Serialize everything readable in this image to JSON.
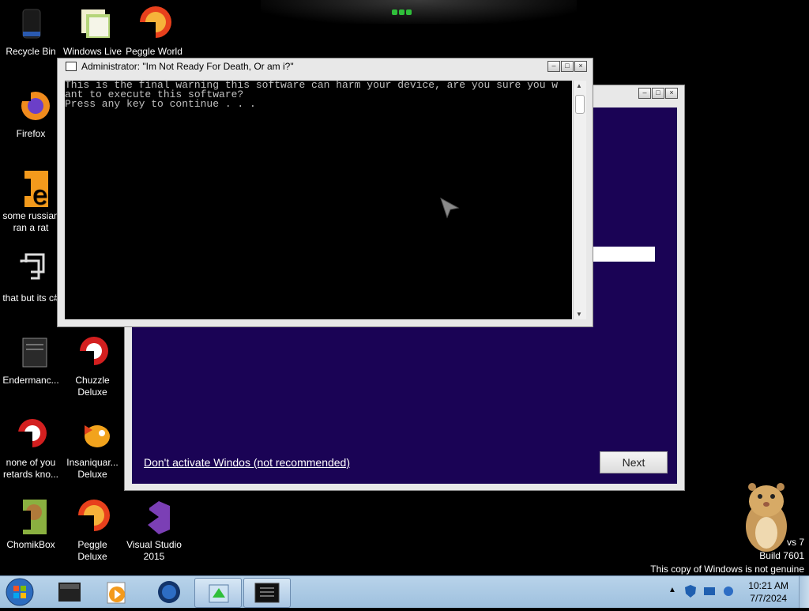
{
  "desktop": {
    "icons": [
      {
        "name": "recycle-bin-icon",
        "label": "Recycle Bin"
      },
      {
        "name": "windows-live-icon",
        "label": "Windows Live"
      },
      {
        "name": "peggle-world-icon",
        "label": "Peggle World"
      },
      {
        "name": "firefox-icon",
        "label": "Firefox"
      },
      {
        "name": "rat-icon",
        "label": "some russian ran a rat"
      },
      {
        "name": "csharp-icon",
        "label": "that but its c#"
      },
      {
        "name": "enderman-icon",
        "label": "Endermanc..."
      },
      {
        "name": "chuzzle-icon",
        "label": "Chuzzle Deluxe"
      },
      {
        "name": "none-of-you-icon",
        "label": "none of you retards kno..."
      },
      {
        "name": "insaniquarium-icon",
        "label": "Insaniquar... Deluxe"
      },
      {
        "name": "chomikbox-icon",
        "label": "ChomikBox"
      },
      {
        "name": "peggle-deluxe-icon",
        "label": "Peggle Deluxe"
      },
      {
        "name": "visual-studio-icon",
        "label": "Visual Studio 2015"
      }
    ]
  },
  "setup_window": {
    "link": "Don't activate Windos (not recommended)",
    "next_label": "Next"
  },
  "console_window": {
    "title": "Administrator:  \"Im Not Ready For Death, Or am i?\"",
    "lines": [
      "This is the final warning this software can harm your device, are you sure you w",
      "ant to execute this software?",
      "Press any key to continue . . ."
    ]
  },
  "watermark": {
    "line1": "vs 7",
    "line2": "Build 7601",
    "line3": "This copy of Windows is not genuine"
  },
  "taskbar": {
    "time": "10:21 AM",
    "date": "7/7/2024"
  }
}
